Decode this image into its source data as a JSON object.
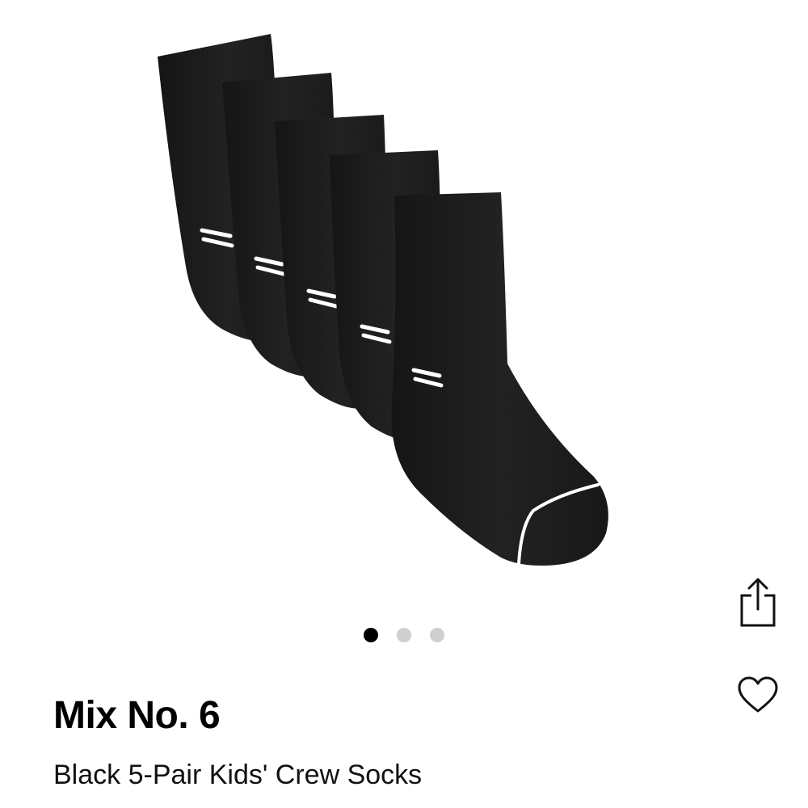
{
  "product": {
    "brand": "Mix No. 6",
    "name": "Black 5-Pair Kids' Crew Socks",
    "image_alt": "Black crew socks with white stripe logo",
    "pack_count": 5,
    "colors": {
      "sock": "#1c1c1c",
      "logo": "#ffffff"
    }
  },
  "carousel": {
    "total_images": 3,
    "active_index": 0,
    "colors": {
      "active": "#000000",
      "inactive": "#cfcfcf"
    }
  },
  "actions": {
    "share_icon": "share-icon",
    "favorite_icon": "heart-outline-icon"
  }
}
